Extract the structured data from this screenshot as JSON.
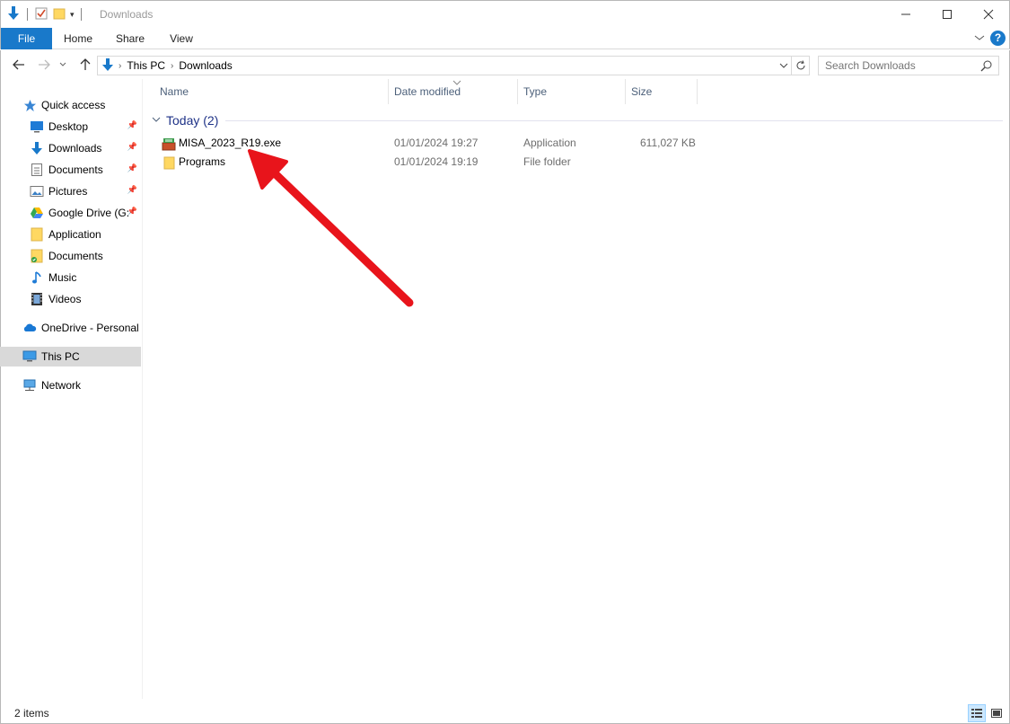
{
  "window": {
    "title": "Downloads",
    "controls": {
      "minimize": "—",
      "maximize": "☐",
      "close": "✕"
    }
  },
  "ribbon": {
    "tabs": [
      {
        "label": "File"
      },
      {
        "label": "Home"
      },
      {
        "label": "Share"
      },
      {
        "label": "View"
      }
    ],
    "help": "?"
  },
  "navigation": {
    "breadcrumb": [
      "This PC",
      "Downloads"
    ],
    "search_placeholder": "Search Downloads"
  },
  "sidebar": {
    "quick_access": "Quick access",
    "items": [
      {
        "label": "Desktop",
        "icon": "desktop-icon",
        "pinned": true
      },
      {
        "label": "Downloads",
        "icon": "downloads-icon",
        "pinned": true
      },
      {
        "label": "Documents",
        "icon": "documents-icon",
        "pinned": true
      },
      {
        "label": "Pictures",
        "icon": "pictures-icon",
        "pinned": true
      },
      {
        "label": "Google Drive (G:",
        "icon": "google-drive-icon",
        "pinned": true
      },
      {
        "label": "Application",
        "icon": "folder-icon",
        "pinned": false
      },
      {
        "label": "Documents",
        "icon": "folder-sync-icon",
        "pinned": false
      },
      {
        "label": "Music",
        "icon": "music-icon",
        "pinned": false
      },
      {
        "label": "Videos",
        "icon": "videos-icon",
        "pinned": false
      }
    ],
    "onedrive": "OneDrive - Personal",
    "this_pc": "This PC",
    "network": "Network"
  },
  "columns": [
    "Name",
    "Date modified",
    "Type",
    "Size"
  ],
  "group": {
    "label": "Today (2)"
  },
  "files": [
    {
      "name": "MISA_2023_R19.exe",
      "date": "01/01/2024 19:27",
      "type": "Application",
      "size": "611,027 KB",
      "icon": "installer-icon"
    },
    {
      "name": "Programs",
      "date": "01/01/2024 19:19",
      "type": "File folder",
      "size": "",
      "icon": "folder-icon"
    }
  ],
  "status": {
    "item_count": "2 items"
  },
  "colors": {
    "accent": "#1979ca",
    "annotation_arrow": "#e8141b",
    "group_title": "#1e3287"
  }
}
